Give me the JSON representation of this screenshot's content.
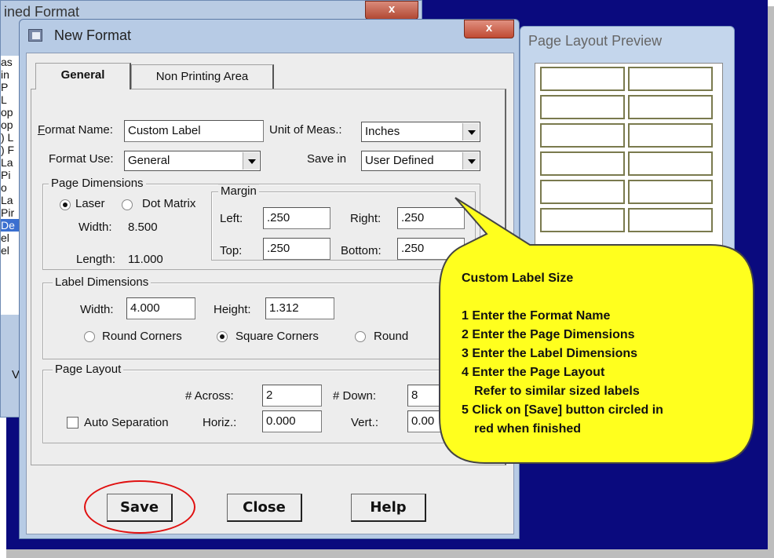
{
  "background_window": {
    "title": "ined Format",
    "close_glyph": "x",
    "list_fragments": [
      "as",
      "in",
      "P",
      "L",
      "op",
      "op",
      ") L",
      ") F",
      "La",
      "Pi",
      "o",
      "La",
      "Pir",
      "De",
      "el",
      "el"
    ],
    "side_text": "V"
  },
  "preview": {
    "title": "Page Layout Preview",
    "columns": 2,
    "rows": 6
  },
  "window": {
    "title": "New Format",
    "close_glyph": "x"
  },
  "tabs": [
    {
      "label": "General",
      "active": true
    },
    {
      "label": "Non Printing Area",
      "active": false
    }
  ],
  "form": {
    "format_name_label": "Format Name:",
    "format_name_value": "Custom Label",
    "unit_label": "Unit of Meas.:",
    "unit_value": "Inches",
    "format_use_label": "Format Use:",
    "format_use_value": "General",
    "save_in_label": "Save in",
    "save_in_value": "User Defined"
  },
  "page_dimensions": {
    "title": "Page Dimensions",
    "laser_label": "Laser",
    "dot_matrix_label": "Dot Matrix",
    "selected": "Laser",
    "width_label": "Width:",
    "width_value": "8.500",
    "length_label": "Length:",
    "length_value": "11.000",
    "margin": {
      "title": "Margin",
      "left_label": "Left:",
      "left_value": ".250",
      "right_label": "Right:",
      "right_value": ".250",
      "top_label": "Top:",
      "top_value": ".250",
      "bottom_label": "Bottom:",
      "bottom_value": ".250"
    }
  },
  "label_dimensions": {
    "title": "Label Dimensions",
    "width_label": "Width:",
    "width_value": "4.000",
    "height_label": "Height:",
    "height_value": "1.312",
    "round_corners_label": "Round Corners",
    "square_corners_label": "Square Corners",
    "round_label": "Round",
    "selected": "Square Corners"
  },
  "page_layout": {
    "title": "Page Layout",
    "across_label": "# Across:",
    "across_value": "2",
    "down_label": "# Down:",
    "down_value": "8",
    "auto_sep_label": "Auto Separation",
    "auto_sep_checked": false,
    "horiz_label": "Horiz.:",
    "horiz_value": "0.000",
    "vert_label": "Vert.:",
    "vert_value": "0.00"
  },
  "buttons": {
    "save": "Save",
    "close": "Close",
    "help": "Help"
  },
  "callout": {
    "title": "Custom Label Size",
    "lines": [
      "1 Enter the Format Name",
      "2 Enter the Page Dimensions",
      "3 Enter the Label Dimensions",
      "4 Enter the Page Layout",
      "Refer to similar sized labels",
      "5 Click on [Save] button circled in",
      "red when finished"
    ],
    "fill_color": "#ffff1e",
    "annotation_color": "#e01010"
  }
}
